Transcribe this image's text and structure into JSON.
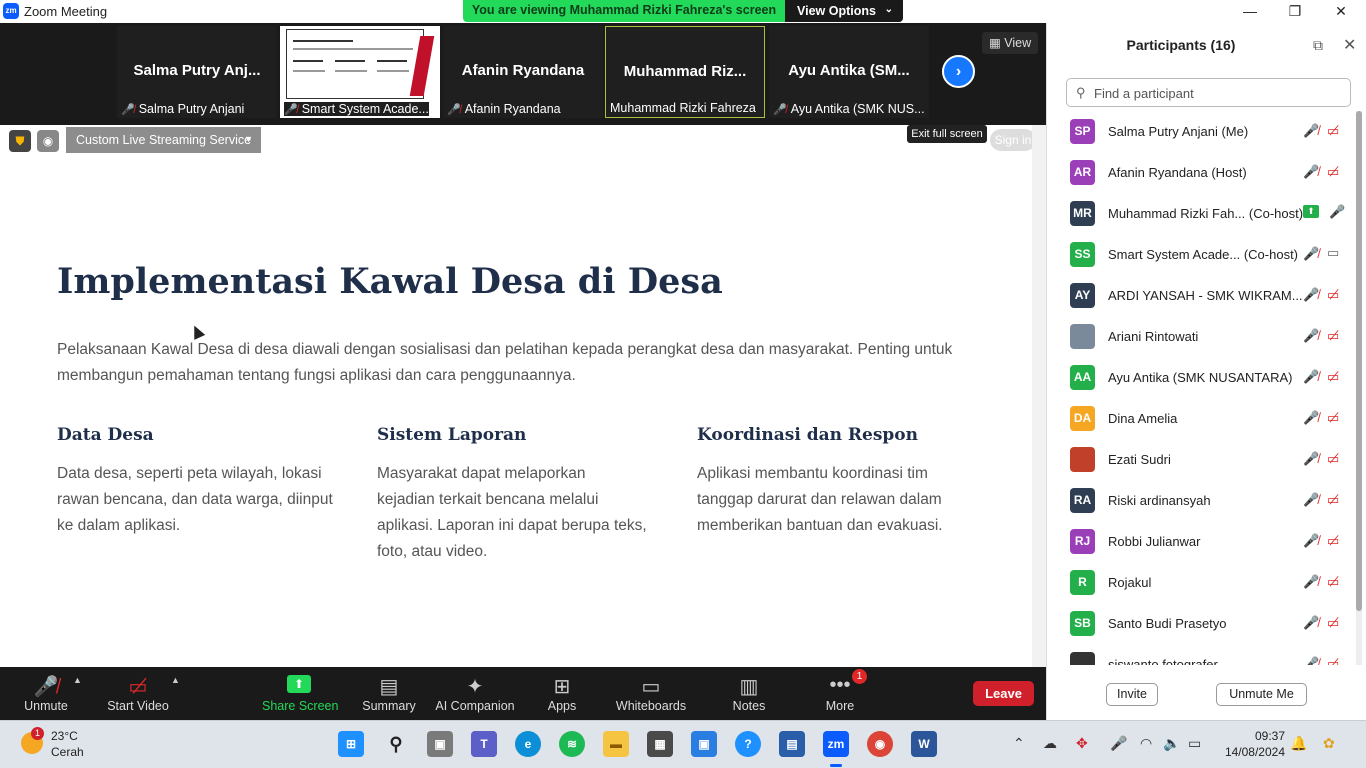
{
  "window": {
    "logo": "zm",
    "title": "Zoom Meeting",
    "banner_text": "You are viewing Muhammad Rizki Fahreza's screen",
    "view_options_label": "View Options",
    "minimize": "—",
    "restore": "❐",
    "close": "✕"
  },
  "strip": {
    "tiles": [
      {
        "name": "Salma Putry Anj...",
        "label": "Salma Putry Anjani",
        "muted": true
      },
      {
        "name": "",
        "label": "Smart System Acade...",
        "muted": true
      },
      {
        "name": "Afanin Ryandana",
        "label": "Afanin Ryandana",
        "muted": true
      },
      {
        "name": "Muhammad Riz...",
        "label": "Muhammad Rizki Fahreza",
        "muted": false
      },
      {
        "name": "Ayu Antika (SM...",
        "label": "Ayu Antika (SMK NUS...",
        "muted": true
      }
    ],
    "view_label": "View"
  },
  "share_toolbar": {
    "live_streaming": "Custom Live Streaming Service",
    "exit_full_screen": "Exit full screen",
    "sign_in": "Sign in"
  },
  "slide": {
    "title": "Implementasi Kawal Desa di Desa",
    "intro": "Pelaksanaan Kawal Desa di desa diawali dengan sosialisasi dan pelatihan kepada perangkat desa dan masyarakat. Penting untuk membangun pemahaman tentang fungsi aplikasi dan cara penggunaannya.",
    "columns": [
      {
        "heading": "Data Desa",
        "text": "Data desa, seperti peta wilayah, lokasi rawan bencana, dan data warga, diinput ke dalam aplikasi."
      },
      {
        "heading": "Sistem Laporan",
        "text": "Masyarakat dapat melaporkan kejadian terkait bencana melalui aplikasi. Laporan ini dapat berupa teks, foto, atau video."
      },
      {
        "heading": "Koordinasi dan Respon",
        "text": "Aplikasi membantu koordinasi tim tanggap darurat dan relawan dalam memberikan bantuan dan evakuasi."
      }
    ]
  },
  "participants": {
    "title": "Participants (16)",
    "search_placeholder": "Find a participant",
    "list": [
      {
        "initials": "SP",
        "name": "Salma Putry Anjani (Me)",
        "color": "#9b3fb8",
        "state": "muted"
      },
      {
        "initials": "AR",
        "name": "Afanin Ryandana (Host)",
        "color": "#9b3fb8",
        "state": "muted"
      },
      {
        "initials": "MR",
        "name": "Muhammad Rizki Fah... (Co-host)",
        "color": "#2f3e52",
        "state": "sharing"
      },
      {
        "initials": "SS",
        "name": "Smart System Acade...   (Co-host)",
        "color": "#23b04a",
        "state": "muted-cam-on"
      },
      {
        "initials": "AY",
        "name": "ARDI YANSAH - SMK WIKRAM...",
        "color": "#2f3e52",
        "state": "muted"
      },
      {
        "initials": "",
        "name": "Ariani Rintowati",
        "color": "#7a8a9a",
        "state": "muted"
      },
      {
        "initials": "AA",
        "name": "Ayu Antika (SMK NUSANTARA)",
        "color": "#23b04a",
        "state": "muted"
      },
      {
        "initials": "DA",
        "name": "Dina Amelia",
        "color": "#f5a623",
        "state": "muted"
      },
      {
        "initials": "",
        "name": "Ezati Sudri",
        "color": "#c0402a",
        "state": "muted"
      },
      {
        "initials": "RA",
        "name": "Riski ardinansyah",
        "color": "#2f3e52",
        "state": "muted"
      },
      {
        "initials": "RJ",
        "name": "Robbi Julianwar",
        "color": "#9b3fb8",
        "state": "muted"
      },
      {
        "initials": "R",
        "name": "Rojakul",
        "color": "#23b04a",
        "state": "muted"
      },
      {
        "initials": "SB",
        "name": "Santo Budi Prasetyo",
        "color": "#23b04a",
        "state": "muted"
      },
      {
        "initials": "",
        "name": "siswanto fotografer",
        "color": "#333333",
        "state": "muted"
      }
    ],
    "invite": "Invite",
    "unmute_me": "Unmute Me"
  },
  "toolbar": {
    "unmute": "Unmute",
    "start_video": "Start Video",
    "share_screen": "Share Screen",
    "summary": "Summary",
    "ai_companion": "AI Companion",
    "apps": "Apps",
    "whiteboards": "Whiteboards",
    "notes": "Notes",
    "more": "More",
    "more_badge": "1",
    "leave": "Leave"
  },
  "taskbar": {
    "weather_badge": "1",
    "temperature": "23°C",
    "condition": "Cerah",
    "time": "09:37",
    "date": "14/08/2024"
  }
}
